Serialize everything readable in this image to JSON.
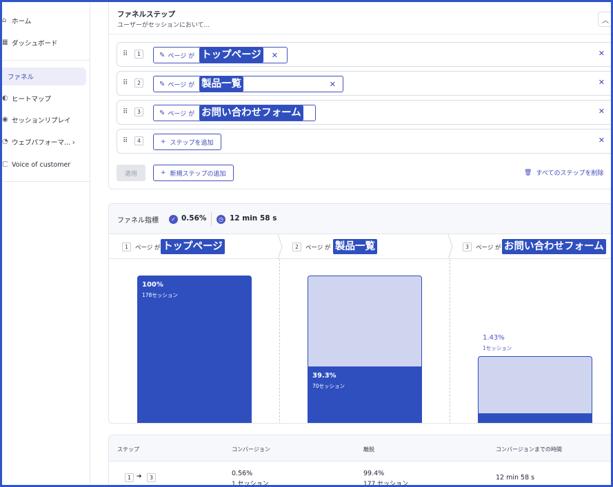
{
  "sidebar": {
    "items": [
      {
        "label": "ホーム",
        "icon": "home-icon"
      },
      {
        "label": "ダッシュボード",
        "icon": "dashboard-icon"
      },
      {
        "label": "ファネル",
        "icon": "funnel-icon",
        "active": true
      },
      {
        "label": "ヒートマップ",
        "icon": "heatmap-icon"
      },
      {
        "label": "セッションリプレイ",
        "icon": "replay-icon"
      },
      {
        "label": "ウェブパフォーマ...",
        "icon": "performance-icon"
      },
      {
        "label": "Voice of customer",
        "icon": "voc-icon"
      }
    ]
  },
  "steps_card": {
    "title": "ファネルステップ",
    "subtitle": "ユーザーがセッションにおいて...",
    "condition_label": "ページ が",
    "steps": [
      {
        "num": "1",
        "page": "トップページ"
      },
      {
        "num": "2",
        "page": "製品一覧"
      },
      {
        "num": "3",
        "page": "お問い合わせフォーム"
      }
    ],
    "add_step": {
      "num": "4",
      "label": "ステップを追加"
    },
    "apply_label": "適用",
    "new_step_label": "新規ステップの追加",
    "delete_all_label": "すべてのステップを削除"
  },
  "metrics": {
    "label": "ファネル指標",
    "conversion": "0.56%",
    "duration": "12 min 58 s"
  },
  "chart_data": {
    "type": "bar",
    "categories": [
      "トップページ",
      "製品一覧",
      "お問い合わせフォーム"
    ],
    "values_percent": [
      100,
      39.3,
      1.43
    ],
    "sessions": [
      178,
      70,
      1
    ],
    "ylim": [
      0,
      100
    ],
    "labels": [
      {
        "pct": "100%",
        "sess": "178セッション"
      },
      {
        "pct": "39.3%",
        "sess": "70セッション"
      },
      {
        "pct": "1.43%",
        "sess": "1セッション"
      }
    ]
  },
  "table": {
    "headers": [
      "ステップ",
      "コンバージョン",
      "離脱",
      "コンバージョンまでの時間"
    ],
    "rows": [
      {
        "from": "1",
        "to": "3",
        "conversion": "0.56%",
        "conversion_sessions": "1 セッション",
        "dropoff": "99.4%",
        "dropoff_sessions": "177 セッション",
        "time": "12 min 58 s"
      }
    ]
  },
  "colors": {
    "accent": "#2f4fbf",
    "accent_light": "#d0d5ef",
    "frame": "#2f55c7"
  }
}
